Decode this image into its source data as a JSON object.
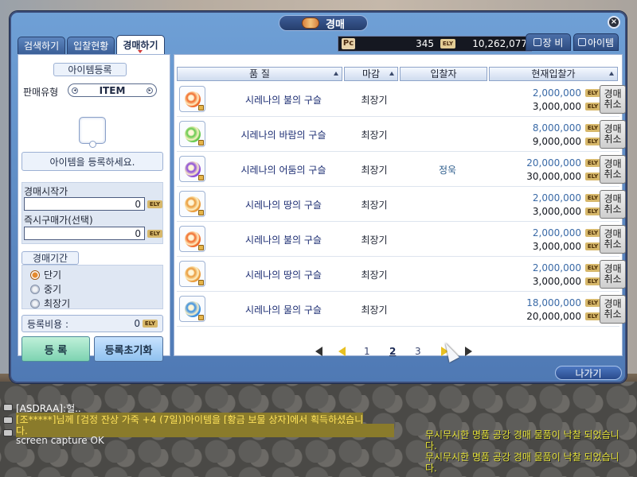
{
  "window": {
    "title": "경매",
    "close_label": "×",
    "tabs": [
      "검색하기",
      "입찰현황",
      "경매하기"
    ],
    "active_tab": "경매하기",
    "wallet": {
      "pc_icon": "Pc",
      "pc_value": "345",
      "ely_icon": "ELY",
      "ely_value": "10,262,077"
    },
    "right_tabs": [
      "장 비",
      "아이템"
    ],
    "exit_label": "나가기"
  },
  "register": {
    "header": "아이템등록",
    "sale_type_label": "판매유형",
    "sale_type_value": "ITEM",
    "slot_hint": "아이템을 등록하세요.",
    "start_price_label": "경매시작가",
    "start_price_value": "0",
    "buyout_label": "즉시구매가(선택)",
    "buyout_value": "0",
    "period_label": "경매기간",
    "periods": [
      {
        "label": "단기",
        "selected": true
      },
      {
        "label": "중기",
        "selected": false
      },
      {
        "label": "최장기",
        "selected": false
      }
    ],
    "fee_label": "등록비용 :",
    "fee_value": "0",
    "register_button": "등 록",
    "reset_button": "등록초기화",
    "ely_tag": "ELY"
  },
  "listing": {
    "columns": [
      "품 질",
      "마감",
      "입찰자",
      "현재입찰가"
    ],
    "cancel_label": "경매\n취소",
    "rows": [
      {
        "name": "시레나의 불의 구슬",
        "deadline": "최장기",
        "bidder": "",
        "current": "2,000,000",
        "buyout": "3,000,000",
        "orb_color": "#f06a2a"
      },
      {
        "name": "시레나의 바람의 구슬",
        "deadline": "최장기",
        "bidder": "",
        "current": "8,000,000",
        "buyout": "9,000,000",
        "orb_color": "#63c94c"
      },
      {
        "name": "시레나의 어둠의 구슬",
        "deadline": "최장기",
        "bidder": "정욱",
        "current": "20,000,000",
        "buyout": "30,000,000",
        "orb_color": "#8a4bd8"
      },
      {
        "name": "시레나의 땅의 구슬",
        "deadline": "최장기",
        "bidder": "",
        "current": "2,000,000",
        "buyout": "3,000,000",
        "orb_color": "#e99a3a"
      },
      {
        "name": "시레나의 불의 구슬",
        "deadline": "최장기",
        "bidder": "",
        "current": "2,000,000",
        "buyout": "3,000,000",
        "orb_color": "#f06a2a"
      },
      {
        "name": "시레나의 땅의 구슬",
        "deadline": "최장기",
        "bidder": "",
        "current": "2,000,000",
        "buyout": "3,000,000",
        "orb_color": "#e99a3a"
      },
      {
        "name": "시레나의 물의 구슬",
        "deadline": "최장기",
        "bidder": "",
        "current": "18,000,000",
        "buyout": "20,000,000",
        "orb_color": "#3a8fe0"
      }
    ],
    "pages": [
      "1",
      "2",
      "3"
    ],
    "current_page": "2"
  },
  "chat": {
    "lines": [
      {
        "text": "[ASDRAA]:헐..",
        "color": "#ffffff"
      },
      {
        "text": "[조*****]님께 [검정 잔상 가죽 +4 (7일)]아이템을 [황금 보물 상자]에서 획득하셨습니",
        "color": "#ffe35a"
      },
      {
        "text": "다.",
        "color": "#ffe35a"
      },
      {
        "text": "screen capture OK",
        "color": "#f1f1f1"
      }
    ],
    "notices": [
      "무시무시한 명품 공강 경매 물품이 낙찰 되었습니다.",
      "무시무시한 명품 공강 경매 물품이 낙찰 되었습니다."
    ]
  }
}
